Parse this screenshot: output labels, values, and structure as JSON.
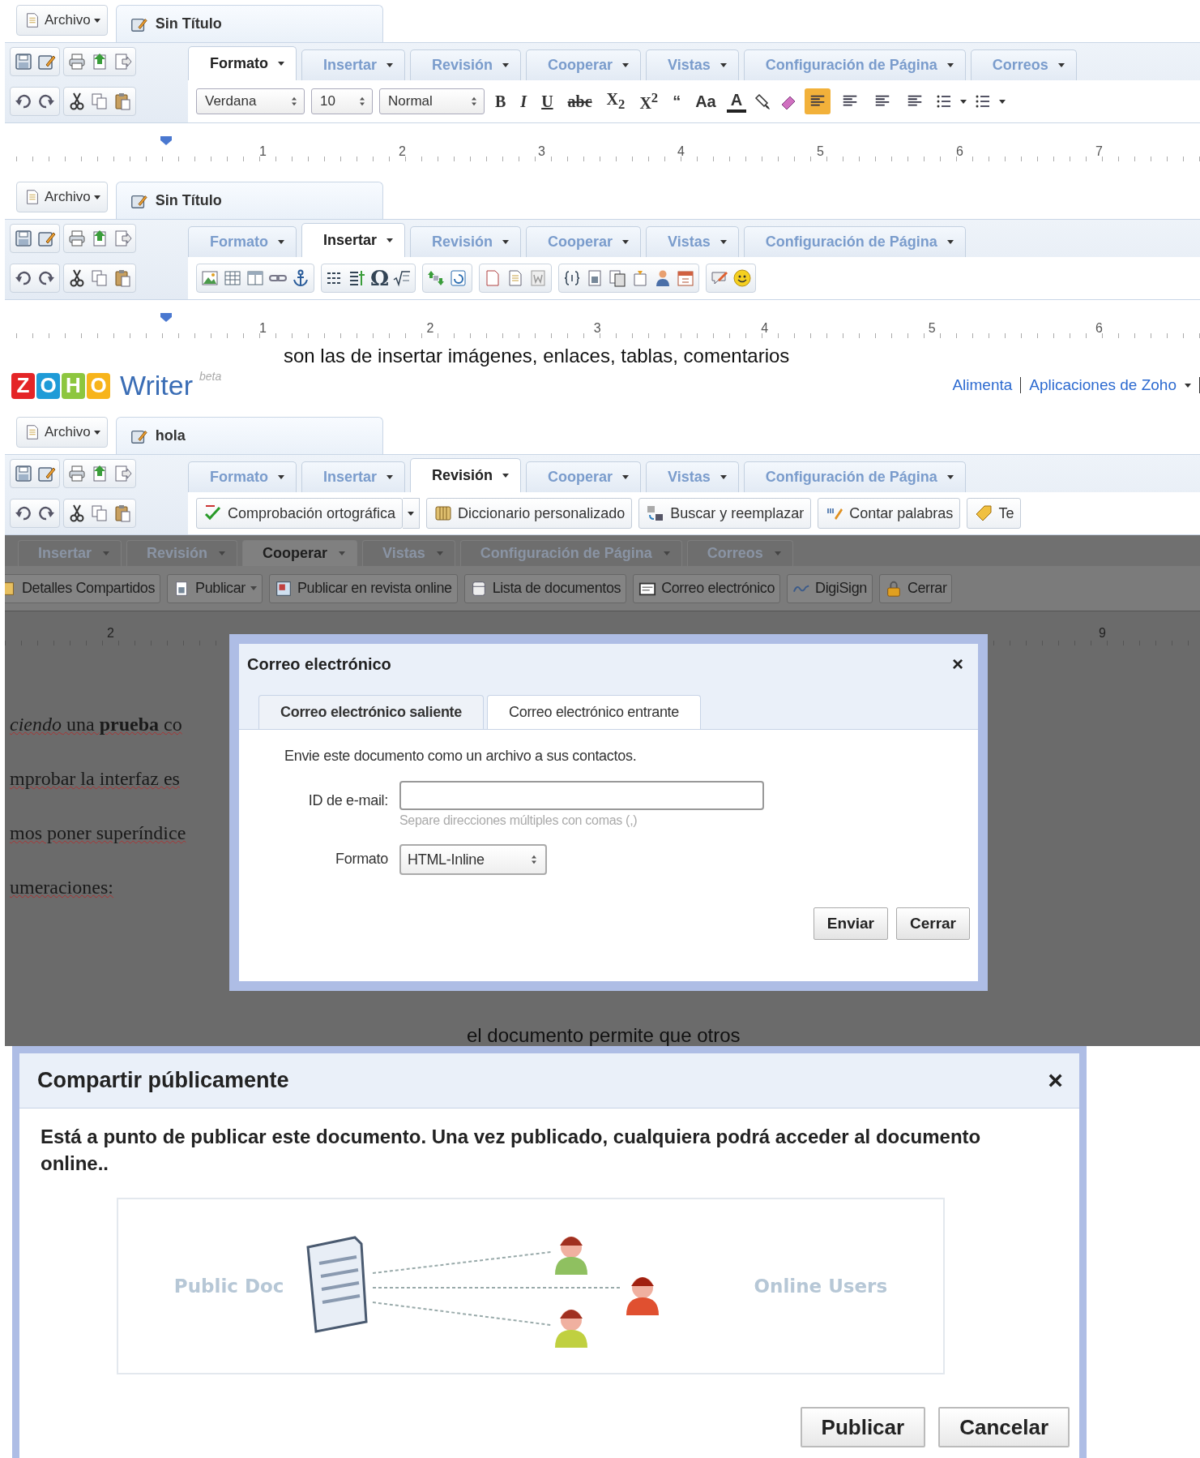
{
  "panels": [
    {
      "kind": "editor",
      "file_menu": "Archivo",
      "document_title": "Sin Título",
      "tabs": [
        {
          "label": "Formato",
          "selected": true
        },
        {
          "label": "Insertar",
          "selected": false
        },
        {
          "label": "Revisión",
          "selected": false
        },
        {
          "label": "Cooperar",
          "selected": false
        },
        {
          "label": "Vistas",
          "selected": false
        },
        {
          "label": "Configuración de Página",
          "selected": false
        },
        {
          "label": "Correos",
          "selected": false
        }
      ],
      "toolbar": {
        "kind": "format",
        "font_name": "Verdana",
        "font_size": "10",
        "paragraph_style": "Normal",
        "style_buttons": [
          "B",
          "I",
          "U",
          "abc",
          "X$_{2}$",
          "X$^{2}$",
          "“",
          "Aa"
        ],
        "text_color_button": "A",
        "alignments": [
          {
            "selected": true
          },
          {
            "selected": false
          },
          {
            "selected": false
          },
          {
            "selected": false
          }
        ]
      },
      "ruler_numbers": [
        "1",
        "2",
        "3",
        "4",
        "5",
        "6",
        "7"
      ]
    },
    {
      "kind": "editor",
      "file_menu": "Archivo",
      "document_title": "Sin Título",
      "tabs": [
        {
          "label": "Formato",
          "selected": false
        },
        {
          "label": "Insertar",
          "selected": true
        },
        {
          "label": "Revisión",
          "selected": false
        },
        {
          "label": "Cooperar",
          "selected": false
        },
        {
          "label": "Vistas",
          "selected": false
        },
        {
          "label": "Configuración de Página",
          "selected": false
        }
      ],
      "toolbar": {
        "kind": "insert",
        "symbol_button": "Ω"
      },
      "ruler_numbers": [
        "1",
        "2",
        "3",
        "4",
        "5",
        "6"
      ]
    },
    {
      "kind": "caption",
      "text": "son las de insertar imágenes, enlaces, tablas, comentarios"
    },
    {
      "kind": "editor",
      "header": {
        "logo_letters": [
          {
            "letter": "Z",
            "color": "#e42527"
          },
          {
            "letter": "O",
            "color": "#1f9bd7"
          },
          {
            "letter": "H",
            "color": "#8dc63f"
          },
          {
            "letter": "O",
            "color": "#f7b41b"
          }
        ],
        "product": "Writer",
        "badge": "beta",
        "links": [
          "Alimenta",
          "Aplicaciones de Zoho"
        ]
      },
      "file_menu": "Archivo",
      "document_title": "hola",
      "tabs": [
        {
          "label": "Formato",
          "selected": false
        },
        {
          "label": "Insertar",
          "selected": false
        },
        {
          "label": "Revisión",
          "selected": true
        },
        {
          "label": "Cooperar",
          "selected": false
        },
        {
          "label": "Vistas",
          "selected": false
        },
        {
          "label": "Configuración de Página",
          "selected": false
        }
      ],
      "toolbar": {
        "kind": "review",
        "items": [
          "Comprobación ortográfica",
          "Diccionario personalizado",
          "Buscar y reemplazar",
          "Contar palabras",
          "Te"
        ]
      }
    },
    {
      "kind": "sharing",
      "tabs": [
        {
          "label": "Insertar",
          "selected": false
        },
        {
          "label": "Revisión",
          "selected": false
        },
        {
          "label": "Cooperar",
          "selected": true
        },
        {
          "label": "Vistas",
          "selected": false
        },
        {
          "label": "Configuración de Página",
          "selected": false
        },
        {
          "label": "Correos",
          "selected": false
        }
      ],
      "buttons": [
        "Detalles Compartidos",
        "Publicar",
        "Publicar en revista online",
        "Lista de documentos",
        "Correo electrónico",
        "DigiSign",
        "Cerrar"
      ],
      "ruler_numbers": [
        "2",
        "9"
      ],
      "document_lines": [
        "*ciendo* una **prueba** co",
        "mprobar la interfaz es",
        "mos poner superíndice",
        "umeraciones:"
      ],
      "email_dialog": {
        "title": "Correo electrónico",
        "close": "×",
        "tabs": [
          {
            "label": "Correo electrónico saliente",
            "selected": true
          },
          {
            "label": "Correo electrónico entrante",
            "selected": false
          }
        ],
        "intro": "Envie este documento como un archivo a sus contactos.",
        "email_label": "ID de e-mail:",
        "email_hint": "Separe direcciones múltiples con comas (,)",
        "format_label": "Formato",
        "format_value": "HTML-Inline",
        "buttons": [
          "Enviar",
          "Cerrar"
        ]
      }
    },
    {
      "kind": "caption",
      "text": "el documento permite que otros"
    },
    {
      "kind": "publish_dialog",
      "title": "Compartir públicamente",
      "close": "×",
      "message": "Está a punto de publicar este documento. Una vez publicado, cualquiera podrá acceder al documento online..",
      "doc_label": "Public Doc",
      "users_label": "Online Users",
      "buttons": [
        "Publicar",
        "Cancelar"
      ]
    }
  ]
}
